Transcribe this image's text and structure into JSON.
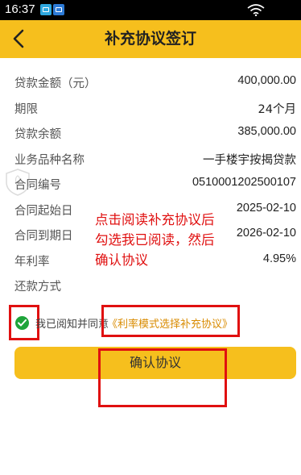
{
  "status_bar": {
    "time": "16:37"
  },
  "header": {
    "title": "补充协议签订"
  },
  "info": [
    {
      "label": "贷款金额（元）",
      "value": "400,000.00"
    },
    {
      "label": "期限",
      "value": "24个月"
    },
    {
      "label": "贷款余额",
      "value": "385,000.00"
    },
    {
      "label": "业务品种名称",
      "value": "一手楼宇按揭贷款"
    },
    {
      "label": "合同编号",
      "value": "0510001202500107"
    },
    {
      "label": "合同起始日",
      "value": "2025-02-10"
    },
    {
      "label": "合同到期日",
      "value": "2026-02-10"
    },
    {
      "label": "年利率",
      "value": "4.95%"
    },
    {
      "label": "还款方式",
      "value": ""
    }
  ],
  "annotation": {
    "line1": "点击阅读补充协议后",
    "line2": "勾选我已阅读，然后",
    "line3": "确认协议"
  },
  "agreement": {
    "text": "我已阅知并同意",
    "link": "《利率模式选择补充协议》",
    "checked": true
  },
  "confirm": {
    "label": "确认协议"
  },
  "colors": {
    "accent": "#f6bf1d",
    "annotation_red": "#e01010",
    "check_green": "#1ea43a",
    "link": "#d98b00"
  }
}
